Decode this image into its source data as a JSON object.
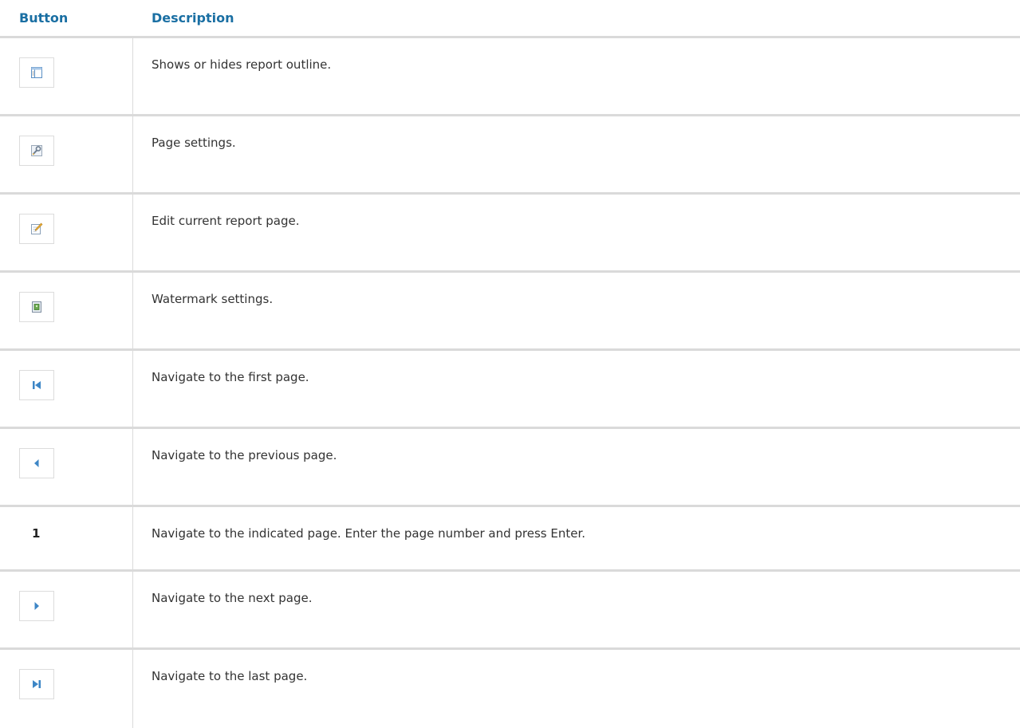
{
  "table": {
    "header": {
      "button": "Button",
      "description": "Description"
    },
    "rows": [
      {
        "icon": "outline-icon",
        "description": "Shows or hides report outline."
      },
      {
        "icon": "page-settings-icon",
        "description": "Page settings."
      },
      {
        "icon": "edit-page-icon",
        "description": "Edit current report page."
      },
      {
        "icon": "watermark-icon",
        "description": "Watermark settings."
      },
      {
        "icon": "first-page-icon",
        "description": "Navigate to the first page."
      },
      {
        "icon": "previous-page-icon",
        "description": "Navigate to the previous page."
      },
      {
        "page_number": "1",
        "description": "Navigate to the indicated page. Enter the page number and press Enter."
      },
      {
        "icon": "next-page-icon",
        "description": "Navigate to the next page."
      },
      {
        "icon": "last-page-icon",
        "description": "Navigate to the last page."
      }
    ]
  },
  "colors": {
    "header_text": "#1a6fa3",
    "body_text": "#333333",
    "border": "#dadada",
    "nav_arrow": "#3d86c6"
  }
}
